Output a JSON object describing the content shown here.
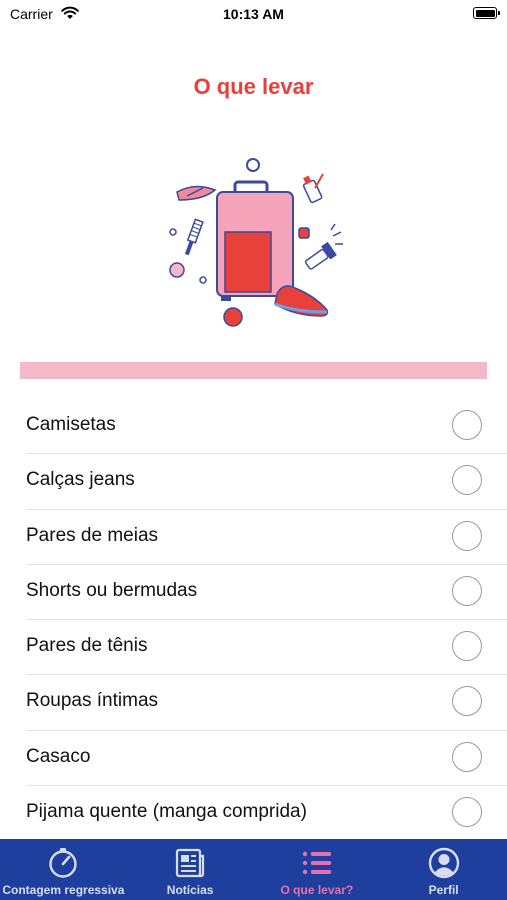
{
  "status_bar": {
    "carrier": "Carrier",
    "time": "10:13 AM"
  },
  "page": {
    "title": "O que levar"
  },
  "progress": {
    "packed_fraction": 0
  },
  "checklist": [
    {
      "label": "Camisetas",
      "checked": false
    },
    {
      "label": "Calças jeans",
      "checked": false
    },
    {
      "label": "Pares de meias",
      "checked": false
    },
    {
      "label": "Shorts ou bermudas",
      "checked": false
    },
    {
      "label": "Pares de tênis",
      "checked": false
    },
    {
      "label": "Roupas íntimas",
      "checked": false
    },
    {
      "label": "Casaco",
      "checked": false
    },
    {
      "label": "Pijama quente (manga comprida)",
      "checked": false
    }
  ],
  "tab_bar": {
    "tabs": [
      {
        "label": "Contagem regressiva",
        "icon": "stopwatch-icon"
      },
      {
        "label": "Notícias",
        "icon": "newspaper-icon"
      },
      {
        "label": "O que levar?",
        "icon": "list-icon",
        "active": true
      },
      {
        "label": "Perfil",
        "icon": "person-circle-icon"
      }
    ]
  },
  "colors": {
    "accent": "#e8403a",
    "progress_track": "#f5b8c8",
    "tab_bar_background": "#1e3f9e",
    "tab_active": "#e96fae",
    "tab_inactive": "#d8def0"
  }
}
